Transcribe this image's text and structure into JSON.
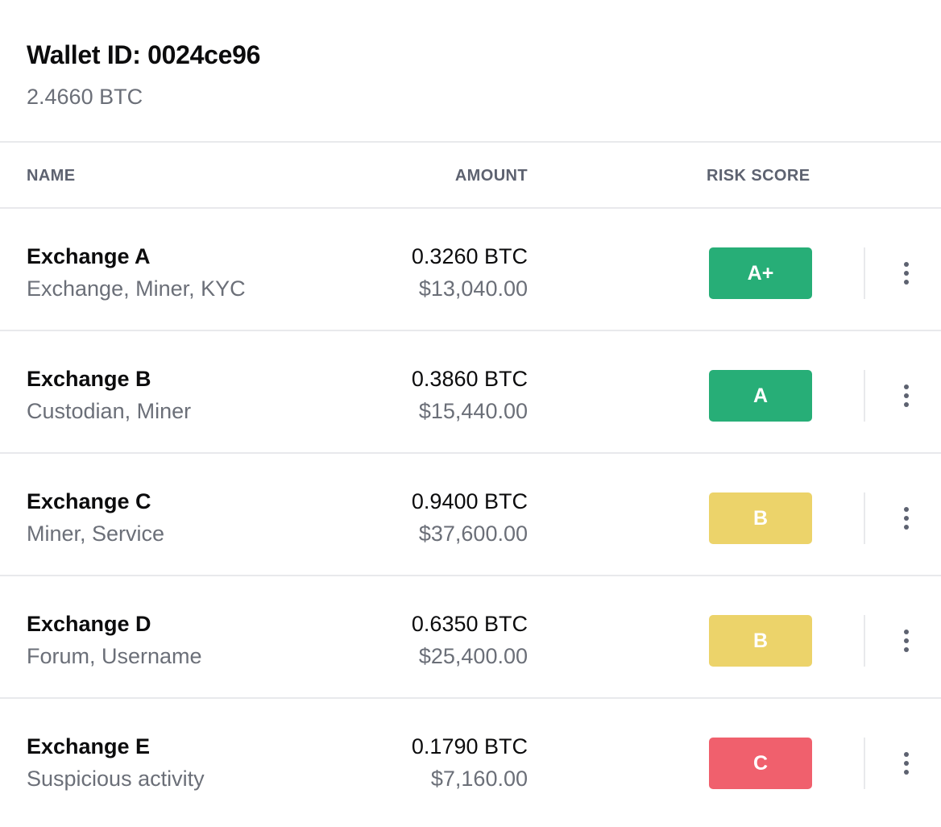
{
  "wallet": {
    "title": "Wallet ID: 0024ce96",
    "balance": "2.4660 BTC"
  },
  "columns": {
    "name": "NAME",
    "amount": "AMOUNT",
    "risk": "RISK SCORE"
  },
  "colors": {
    "green": "#27ae77",
    "yellow": "#ecd36a",
    "red": "#f0606d"
  },
  "rows": [
    {
      "name": "Exchange A",
      "tags": "Exchange, Miner, KYC",
      "btc": "0.3260 BTC",
      "usd": "$13,040.00",
      "score": "A+",
      "color": "#27ae77"
    },
    {
      "name": "Exchange B",
      "tags": "Custodian, Miner",
      "btc": "0.3860 BTC",
      "usd": "$15,440.00",
      "score": "A",
      "color": "#27ae77"
    },
    {
      "name": "Exchange C",
      "tags": "Miner, Service",
      "btc": "0.9400 BTC",
      "usd": "$37,600.00",
      "score": "B",
      "color": "#ecd36a"
    },
    {
      "name": "Exchange D",
      "tags": "Forum, Username",
      "btc": "0.6350 BTC",
      "usd": "$25,400.00",
      "score": "B",
      "color": "#ecd36a"
    },
    {
      "name": "Exchange E",
      "tags": "Suspicious activity",
      "btc": "0.1790 BTC",
      "usd": "$7,160.00",
      "score": "C",
      "color": "#f0606d"
    }
  ],
  "icons": {
    "more": "more-vertical-icon"
  }
}
